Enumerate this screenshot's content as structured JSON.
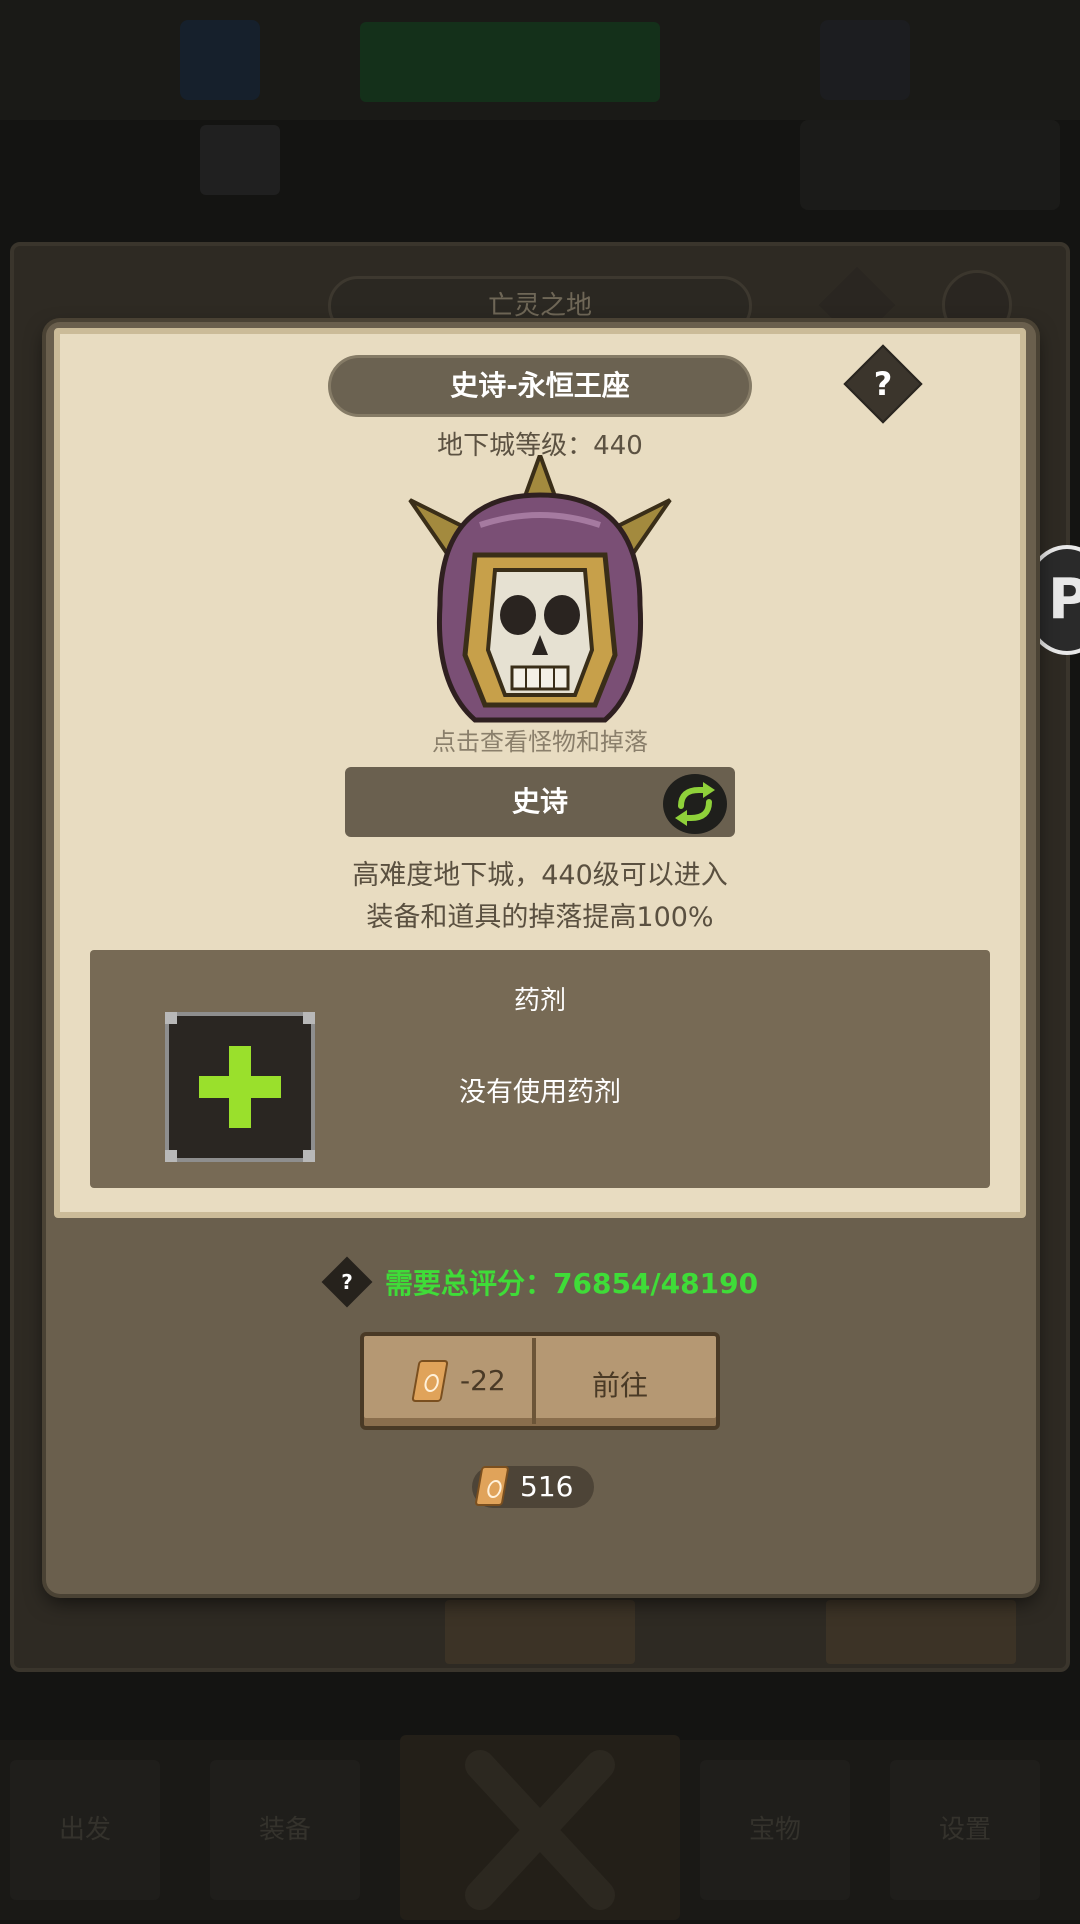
{
  "background": {
    "title": "亡灵之地",
    "bottom_tabs": [
      "出发",
      "装备",
      "",
      "宝物",
      "设置"
    ]
  },
  "side_badge": {
    "letter": "P"
  },
  "dialog": {
    "title": "史诗-永恒王座",
    "help_label": "?",
    "dungeon_level": "地下城等级：440",
    "boss_hint": "点击查看怪物和掉落",
    "difficulty": "史诗",
    "description_lines": [
      "高难度地下城，440级可以进入",
      "装备和道具的掉落提高100%"
    ],
    "potion": {
      "title": "药剂",
      "status": "没有使用药剂"
    },
    "score": {
      "help_label": "?",
      "text": "需要总评分：76854/48190",
      "color": "#3fdc38"
    },
    "go_button": {
      "cost": "-22",
      "label": "前往"
    },
    "balance": "516"
  }
}
